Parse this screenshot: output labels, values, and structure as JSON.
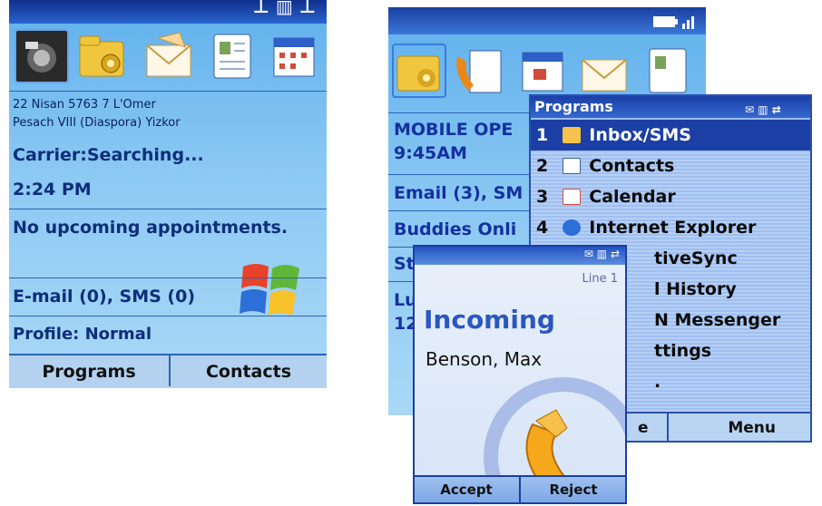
{
  "phone1": {
    "icons": [
      "camera-icon",
      "folder-gear-icon",
      "envelope-icon",
      "contacts-icon",
      "calendar-icon"
    ],
    "line1": "22 Nisan 5763    7 L'Omer",
    "line2": "Pesach VIII (Diaspora)    Yizkor",
    "carrier": "Carrier:Searching...",
    "time": "2:24 PM",
    "appointments": "No upcoming appointments.",
    "messages": "E-mail (0), SMS (0)",
    "profile": "Profile: Normal",
    "softkey_left": "Programs",
    "softkey_right": "Contacts"
  },
  "phone2": {
    "icons": [
      "folder-gear-icon",
      "phone-doc-icon",
      "calendar-icon",
      "envelope-icon",
      "contacts-icon"
    ],
    "operator": "MOBILE OPE",
    "time": "9:45AM",
    "email": "Email (3), SM",
    "buddies": "Buddies Onli",
    "row4": "St",
    "row5a": "Lu",
    "row5b": "12"
  },
  "menu": {
    "title": "Programs",
    "items": [
      {
        "num": "1",
        "label": "Inbox/SMS",
        "icon": "inbox-icon"
      },
      {
        "num": "2",
        "label": "Contacts",
        "icon": "contacts-icon"
      },
      {
        "num": "3",
        "label": "Calendar",
        "icon": "calendar-icon"
      },
      {
        "num": "4",
        "label": "Internet Explorer",
        "icon": "internet-explorer-icon"
      },
      {
        "num": "",
        "label": "tiveSync",
        "icon": ""
      },
      {
        "num": "",
        "label": "l History",
        "icon": ""
      },
      {
        "num": "",
        "label": "N Messenger",
        "icon": ""
      },
      {
        "num": "",
        "label": "ttings",
        "icon": ""
      }
    ],
    "softkey_left_partial": "e",
    "softkey_right": "Menu"
  },
  "call": {
    "line": "Line 1",
    "title": "Incoming",
    "name": "Benson, Max",
    "accept": "Accept",
    "reject": "Reject"
  },
  "colors": {
    "brand_blue": "#1b3fa5",
    "screen_blue": "#5fb0ec",
    "text_dark_blue": "#0d2e7a"
  }
}
